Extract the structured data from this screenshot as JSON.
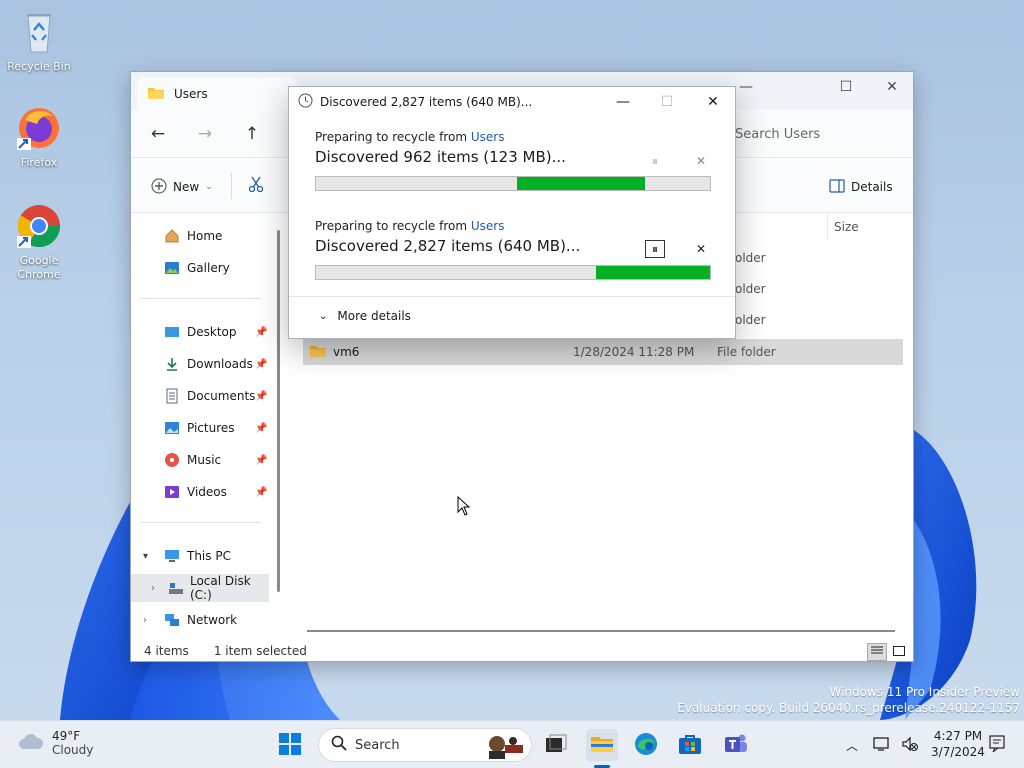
{
  "desktop": {
    "icons": [
      {
        "label": "Recycle Bin"
      },
      {
        "label": "Firefox"
      },
      {
        "label": "Google Chrome"
      }
    ],
    "watermark_line1": "Windows 11 Pro Insider Preview",
    "watermark_line2": "Evaluation copy. Build 26040.rs_prerelease.240122-1157"
  },
  "explorer": {
    "tab_title": "Users",
    "search_placeholder": "Search Users",
    "cmd_new_label": "New",
    "cmd_details_label": "Details",
    "sidebar": {
      "home": "Home",
      "gallery": "Gallery",
      "desktop": "Desktop",
      "downloads": "Downloads",
      "documents": "Documents",
      "pictures": "Pictures",
      "music": "Music",
      "videos": "Videos",
      "this_pc": "This PC",
      "local_disk": "Local Disk (C:)",
      "network": "Network"
    },
    "columns": {
      "size": "Size"
    },
    "rows": [
      {
        "type": "older"
      },
      {
        "type": "older"
      },
      {
        "type": "older"
      },
      {
        "name": "vm6",
        "date": "1/28/2024 11:28 PM",
        "type": "File folder",
        "selected": true
      }
    ],
    "status": {
      "items": "4 items",
      "selected": "1 item selected"
    }
  },
  "dialog": {
    "title": "Discovered 2,827 items (640 MB)...",
    "ops": [
      {
        "sub_prefix": "Preparing to recycle from",
        "sub_link": "Users",
        "main": "Discovered 962 items (123 MB)...",
        "progress_start": 0.51,
        "progress_end": 0.835
      },
      {
        "sub_prefix": "Preparing to recycle from",
        "sub_link": "Users",
        "main": "Discovered 2,827 items (640 MB)...",
        "progress_start": 0.71,
        "progress_end": 1.0
      }
    ],
    "more_details": "More details"
  },
  "taskbar": {
    "weather_temp": "49°F",
    "weather_desc": "Cloudy",
    "search_label": "Search",
    "time": "4:27 PM",
    "date": "3/7/2024"
  },
  "colors": {
    "progress": "#06b025",
    "link": "#1f5ea8",
    "accent": "#0067c0"
  }
}
